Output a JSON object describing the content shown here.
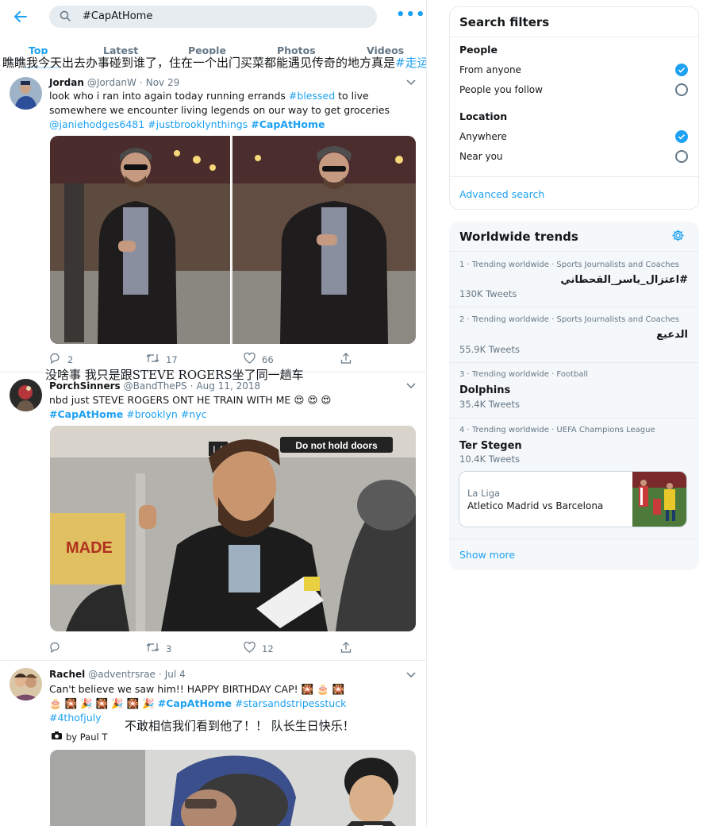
{
  "search": {
    "query": "#CapAtHome"
  },
  "tabs": [
    "Top",
    "Latest",
    "People",
    "Photos",
    "Videos"
  ],
  "overlay": {
    "text": "瞧瞧我今天出去办事碰到谁了，住在一个出门买菜都能遇见传奇的地方真是",
    "tag": "#走运"
  },
  "tweets": [
    {
      "name": "Jordan",
      "handle": "@JordanW",
      "date": "Nov 29",
      "text_plain": "look who i ran into again today running errands ",
      "tag1": "#blessed",
      "text_2": " to live somewhere we encounter living legends on our way to get groceries ",
      "mention": "@janiehodges6481",
      "tag2": "#justbrooklynthings",
      "tag3": "#CapAtHome",
      "replies": "2",
      "retweets": "17",
      "likes": "66"
    },
    {
      "name": "PorchSinners",
      "handle": "@BandThePS",
      "date": "Aug 11, 2018",
      "caption_cn": "没啥事 我只是跟STEVE ROGERS坐了同一趟车",
      "text_plain": "nbd just STEVE ROGERS ONT HE TRAIN WITH ME",
      "emoji": "😍 😍 😍",
      "tag1": "#CapAtHome",
      "tag2": "#brooklyn",
      "tag3": "#nyc",
      "sign_text": "Do not hold doors",
      "car_number": "L4",
      "poster_text": "MADE",
      "replies": "",
      "retweets": "3",
      "likes": "12"
    },
    {
      "name": "Rachel",
      "handle": "@adventrsrae",
      "date": "Jul 4",
      "text_plain": "Can't believe we saw him!! HAPPY BIRTHDAY CAP!",
      "emoji1": "🎇 🎂 🎇",
      "emoji2": "🎂 🎇 🎉 🎇 🎉 🎇 🎉",
      "tag1": "#CapAtHome",
      "tag2": "#starsandstripesstuck",
      "tag3": "#4thofjuly",
      "caption_cn": "不敢相信我们看到他了！！ 队长生日快乐！",
      "credit": "by Paul T"
    }
  ],
  "filters": {
    "title": "Search filters",
    "people_label": "People",
    "people_opts": [
      "From anyone",
      "People you follow"
    ],
    "location_label": "Location",
    "location_opts": [
      "Anywhere",
      "Near you"
    ],
    "advanced": "Advanced search"
  },
  "trends": {
    "title": "Worldwide trends",
    "items": [
      {
        "meta": "1 · Trending worldwide · Sports Journalists and Coaches",
        "title": "#اعتزال_ياسر_القحطاني",
        "count": "130K Tweets",
        "rtl": true
      },
      {
        "meta": "2 · Trending worldwide · Sports Journalists and Coaches",
        "title": "الدعيع",
        "count": "55.9K Tweets",
        "rtl": true
      },
      {
        "meta": "3 · Trending worldwide · Football",
        "title": "Dolphins",
        "count": "35.4K Tweets",
        "rtl": false
      },
      {
        "meta": "4 · Trending worldwide · UEFA Champions League",
        "title": "Ter Stegen",
        "count": "10.4K Tweets",
        "rtl": false
      }
    ],
    "card": {
      "league": "La Liga",
      "match": "Atletico Madrid vs Barcelona"
    },
    "show_more": "Show more"
  },
  "colors": {
    "accent": "#1da1f2",
    "muted": "#657786",
    "border": "#e6ecf0",
    "panel_bg": "#f5f8fa"
  }
}
